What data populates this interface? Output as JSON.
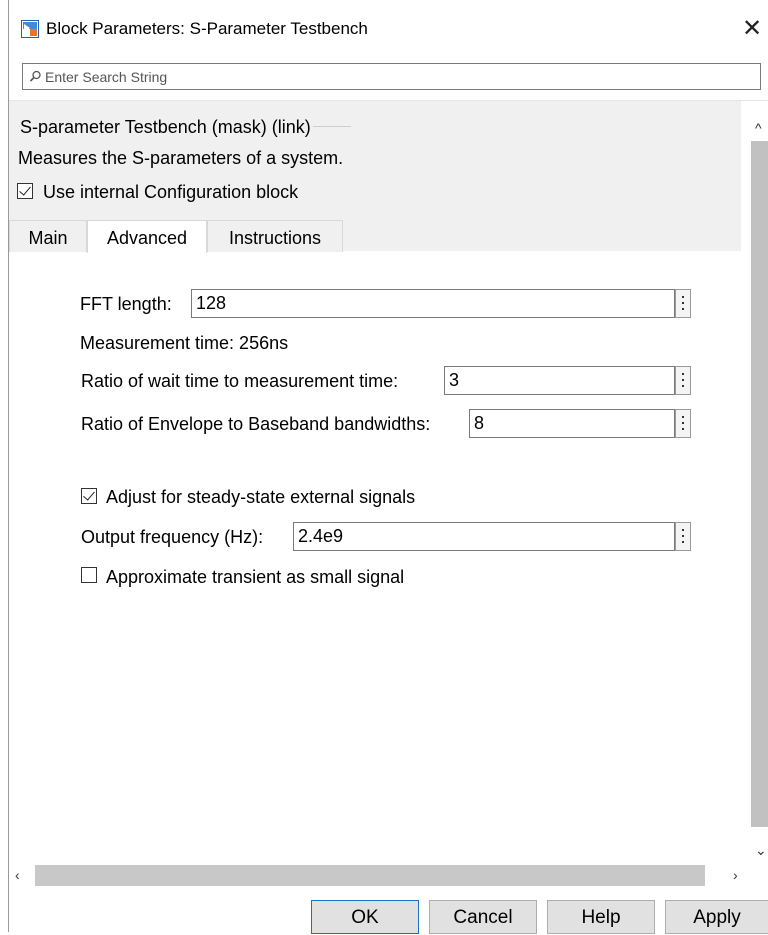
{
  "window": {
    "title": "Block Parameters: S-Parameter Testbench",
    "app_icon": "simulink-block-icon",
    "close_icon": "close-icon"
  },
  "search": {
    "placeholder": "Enter Search String",
    "value": ""
  },
  "description": {
    "title": "S-parameter Testbench (mask) (link)",
    "text": "Measures the S-parameters of a system."
  },
  "use_internal_config": {
    "label": "Use internal Configuration block",
    "checked": true
  },
  "tabs": [
    {
      "label": "Main",
      "active": false
    },
    {
      "label": "Advanced",
      "active": true
    },
    {
      "label": "Instructions",
      "active": false
    }
  ],
  "advanced": {
    "fft_length": {
      "label": "FFT length:",
      "value": "128"
    },
    "measurement_time": "Measurement time: 256ns",
    "wait_ratio": {
      "label": "Ratio of wait time to measurement time:",
      "value": "3"
    },
    "envelope_ratio": {
      "label": "Ratio of Envelope to Baseband bandwidths:",
      "value": "8"
    },
    "adjust_steady_state": {
      "label": "Adjust for steady-state external signals",
      "checked": true
    },
    "output_frequency": {
      "label": "Output frequency (Hz):",
      "value": "2.4e9"
    },
    "approximate_transient": {
      "label": "Approximate transient as small signal",
      "checked": false
    }
  },
  "buttons": {
    "ok": "OK",
    "cancel": "Cancel",
    "help": "Help",
    "apply": "Apply"
  },
  "colors": {
    "panel_gray": "#f0f0f0",
    "default_button_border": "#1a6fc9",
    "scrollbar_thumb": "#c1c1c1"
  }
}
